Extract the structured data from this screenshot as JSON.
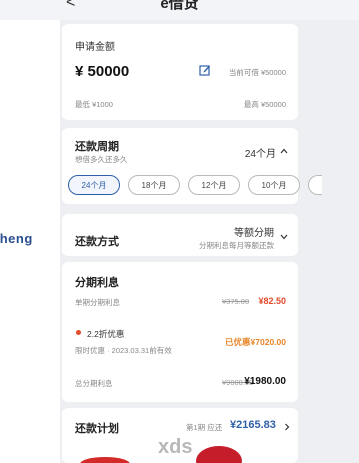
{
  "header": {
    "back_glyph": "<",
    "title": "e借贷"
  },
  "side_text": "cheng",
  "apply_card": {
    "label": "申请金额",
    "amount": "¥ 50000",
    "limit_hint": "当前可借 ¥50000",
    "min_label": "最低 ¥1000",
    "max_label": "最高 ¥50000"
  },
  "period_card": {
    "title": "还款周期",
    "subtitle": "想借多久还多久",
    "selected": "24个月",
    "options": [
      "24个月",
      "18个月",
      "12个月",
      "10个月"
    ]
  },
  "method_card": {
    "title": "还款方式",
    "value": "等额分期",
    "desc": "分期利息每月等额还款"
  },
  "interest_card": {
    "title": "分期利息",
    "row1_label": "单期分期利息",
    "row1_old": "¥375.00",
    "row1_new": "¥82.50",
    "coupon_title": "2.2折优惠",
    "coupon_expiry": "限时优惠 · 2023.03.31前有效",
    "coupon_value": "已优惠¥7020.00",
    "total_label": "总分期利息",
    "total_old": "¥9000.00",
    "total_new": "¥1980.00"
  },
  "plan_card": {
    "title": "还款计划",
    "first_label": "第1期 应还",
    "first_amount": "¥2165.83"
  },
  "watermark": "xds",
  "colors": {
    "accent": "#2e5fa8",
    "discount_red": "#e24a2a",
    "coupon_orange": "#e8862a"
  }
}
